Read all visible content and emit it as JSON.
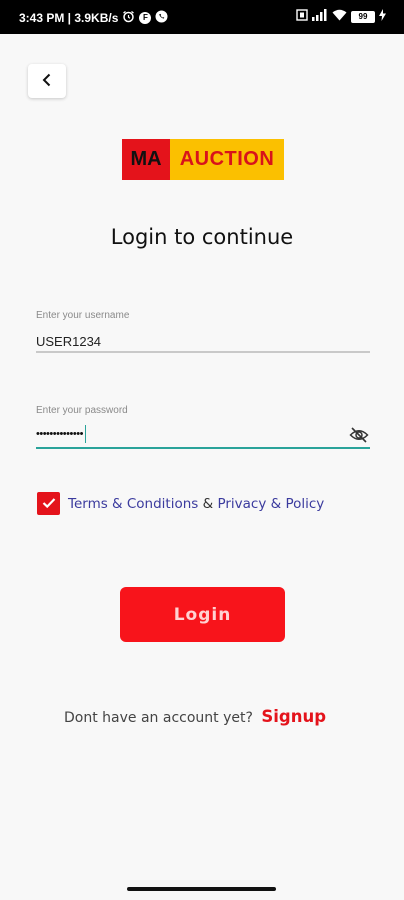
{
  "status_bar": {
    "time_speed": "3:43 PM | 3.9KB/s",
    "battery_level": "99"
  },
  "logo": {
    "part1": "MA",
    "part2": "AUCTION"
  },
  "title": "Login to continue",
  "username": {
    "label": "Enter your username",
    "value": "USER1234"
  },
  "password": {
    "label": "Enter your password",
    "value": "••••••••••••••"
  },
  "terms": {
    "terms_link": "Terms & Conditions",
    "and": "&",
    "privacy_link": "Privacy & Policy"
  },
  "login_button": "Login",
  "signup": {
    "question": "Dont have an account yet?",
    "link": "Signup"
  },
  "colors": {
    "brand_red": "#e4131b",
    "brand_yellow": "#fbc000",
    "accent_teal": "#2aa39a",
    "link_purple": "#3b3b9e"
  },
  "icons": [
    "alarm-icon",
    "f-icon",
    "whatsapp-icon",
    "vibrate-icon",
    "signal-icon",
    "wifi-icon",
    "battery-icon",
    "charging-icon",
    "back-arrow-icon",
    "eye-off-icon",
    "check-icon"
  ]
}
